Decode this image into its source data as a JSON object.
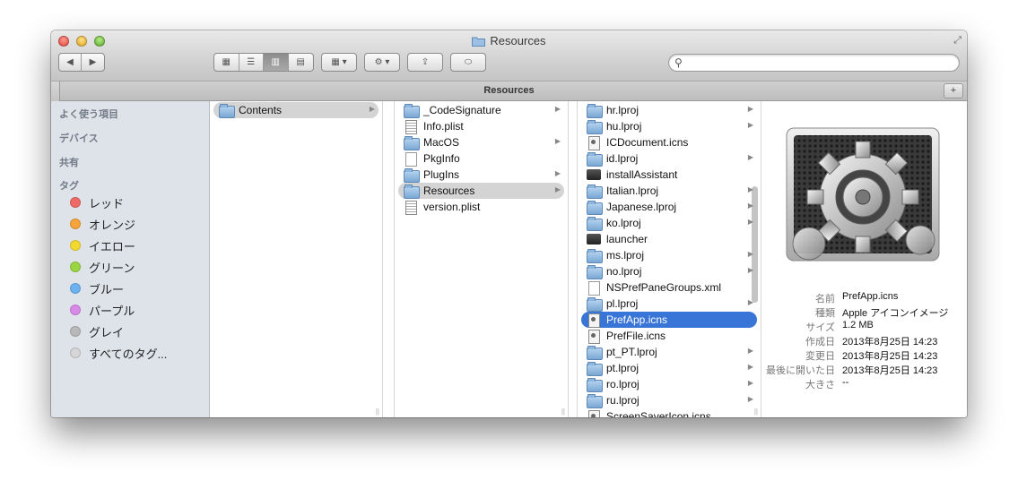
{
  "window": {
    "title": "Resources",
    "path_title": "Resources"
  },
  "toolbar": {
    "back_label": "◀",
    "forward_label": "▶",
    "view_icon": "▦",
    "view_list": "☰",
    "view_column": "▥",
    "view_flow": "▤",
    "arrange_label": "▦ ▾",
    "action_label": "⚙ ▾",
    "share_label": "⇪",
    "tag_label": "⬭",
    "search_placeholder": ""
  },
  "sidebar": {
    "sections": [
      "よく使う項目",
      "デバイス",
      "共有",
      "タグ"
    ],
    "tags": [
      {
        "label": "レッド",
        "color": "#ee6a67"
      },
      {
        "label": "オレンジ",
        "color": "#f5a33a"
      },
      {
        "label": "イエロー",
        "color": "#f3d92f"
      },
      {
        "label": "グリーン",
        "color": "#9ad641"
      },
      {
        "label": "ブルー",
        "color": "#6cb2f0"
      },
      {
        "label": "パープル",
        "color": "#d98ae8"
      },
      {
        "label": "グレイ",
        "color": "#b8b8b8"
      },
      {
        "label": "すべてのタグ...",
        "color": "#d6d6d6"
      }
    ]
  },
  "column1": [
    {
      "name": "Contents",
      "icon": "folder",
      "arrow": true,
      "selected": "gray"
    }
  ],
  "column2": [
    {
      "name": "_CodeSignature",
      "icon": "folder",
      "arrow": true
    },
    {
      "name": "Info.plist",
      "icon": "plist",
      "arrow": false
    },
    {
      "name": "MacOS",
      "icon": "folder",
      "arrow": true
    },
    {
      "name": "PkgInfo",
      "icon": "doc",
      "arrow": false
    },
    {
      "name": "PlugIns",
      "icon": "folder",
      "arrow": true
    },
    {
      "name": "Resources",
      "icon": "folder",
      "arrow": true,
      "selected": "gray"
    },
    {
      "name": "version.plist",
      "icon": "plist",
      "arrow": false
    }
  ],
  "column3": [
    {
      "name": "hr.lproj",
      "icon": "folder",
      "arrow": true
    },
    {
      "name": "hu.lproj",
      "icon": "folder",
      "arrow": true
    },
    {
      "name": "ICDocument.icns",
      "icon": "icns",
      "arrow": false
    },
    {
      "name": "id.lproj",
      "icon": "folder",
      "arrow": true
    },
    {
      "name": "installAssistant",
      "icon": "exec",
      "arrow": false
    },
    {
      "name": "Italian.lproj",
      "icon": "folder",
      "arrow": true
    },
    {
      "name": "Japanese.lproj",
      "icon": "folder",
      "arrow": true
    },
    {
      "name": "ko.lproj",
      "icon": "folder",
      "arrow": true
    },
    {
      "name": "launcher",
      "icon": "exec",
      "arrow": false
    },
    {
      "name": "ms.lproj",
      "icon": "folder",
      "arrow": true
    },
    {
      "name": "no.lproj",
      "icon": "folder",
      "arrow": true
    },
    {
      "name": "NSPrefPaneGroups.xml",
      "icon": "doc",
      "arrow": false
    },
    {
      "name": "pl.lproj",
      "icon": "folder",
      "arrow": true
    },
    {
      "name": "PrefApp.icns",
      "icon": "icns",
      "arrow": false,
      "selected": "blue"
    },
    {
      "name": "PrefFile.icns",
      "icon": "icns",
      "arrow": false
    },
    {
      "name": "pt_PT.lproj",
      "icon": "folder",
      "arrow": true
    },
    {
      "name": "pt.lproj",
      "icon": "folder",
      "arrow": true
    },
    {
      "name": "ro.lproj",
      "icon": "folder",
      "arrow": true
    },
    {
      "name": "ru.lproj",
      "icon": "folder",
      "arrow": true
    },
    {
      "name": "ScreenSaverIcon.icns",
      "icon": "icns",
      "arrow": false
    }
  ],
  "preview": {
    "info": [
      {
        "key": "名前",
        "value": "PrefApp.icns"
      },
      {
        "key": "種類",
        "value": "Apple アイコンイメージ"
      },
      {
        "key": "サイズ",
        "value": "1.2 MB"
      },
      {
        "key": "作成日",
        "value": "2013年8月25日 14:23"
      },
      {
        "key": "変更日",
        "value": "2013年8月25日 14:23"
      },
      {
        "key": "最後に開いた日",
        "value": "2013年8月25日 14:23"
      },
      {
        "key": "大きさ",
        "value": "--"
      }
    ]
  },
  "colors": {
    "selection_blue": "#3875d7",
    "selection_gray": "#d4d4d4",
    "sidebar_bg": "#dee3ea"
  }
}
